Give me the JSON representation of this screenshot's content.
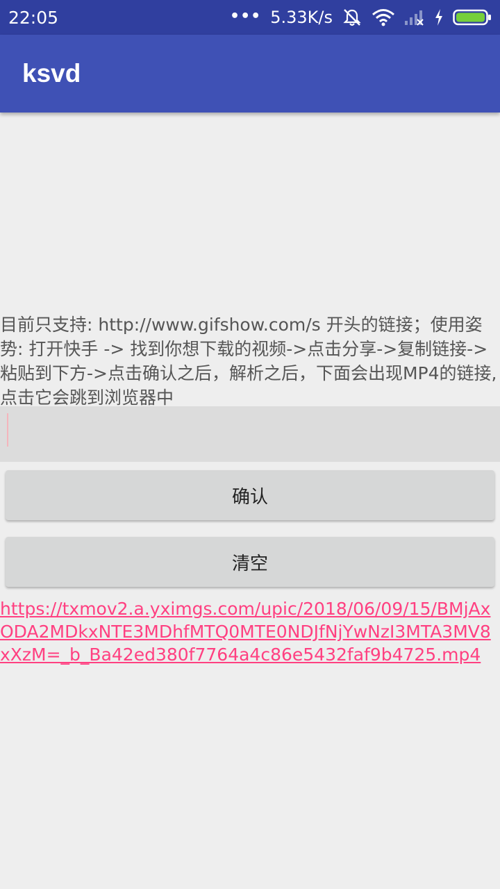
{
  "status_bar": {
    "time": "22:05",
    "dots": "•••",
    "network_speed": "5.33K/s",
    "icons": [
      "alarm-off-icon",
      "wifi-icon",
      "signal-icon",
      "charging-icon",
      "battery-icon"
    ],
    "battery_color": "#76d03b"
  },
  "app_bar": {
    "title": "ksvd",
    "color": "#3f51b5"
  },
  "main": {
    "instructions": "目前只支持: http://www.gifshow.com/s 开头的链接；使用姿势: 打开快手 -> 找到你想下载的视频->点击分享->复制链接->粘贴到下方->点击确认之后，解析之后，下面会出现MP4的链接,点击它会跳到浏览器中",
    "link_input": {
      "value": "",
      "placeholder": ""
    },
    "confirm_button": "确认",
    "clear_button": "清空",
    "result_link": "https://txmov2.a.yximgs.com/upic/2018/06/09/15/BMjAxODA2MDkxNTE3MDhfMTQ0MTE0NDJfNjYwNzI3MTA3MV8xXzM=_b_Ba42ed380f7764a4c86e5432faf9b4725.mp4",
    "link_color": "#ff4081"
  }
}
